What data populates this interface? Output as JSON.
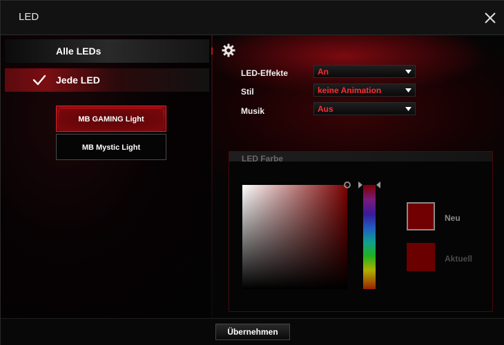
{
  "window": {
    "title": "LED"
  },
  "scope": {
    "all_label": "Alle LEDs",
    "each_label": "Jede LED"
  },
  "devices": [
    {
      "label": "MB GAMING Light",
      "selected": true
    },
    {
      "label": "MB Mystic Light",
      "selected": false
    }
  ],
  "settings": {
    "effects_label": "LED-Effekte",
    "effects_value": "An",
    "style_label": "Stil",
    "style_value": "keine Animation",
    "music_label": "Musik",
    "music_value": "Aus"
  },
  "color": {
    "group_title": "LED Farbe",
    "new_label": "Neu",
    "current_label": "Aktuell",
    "new_color": "#700002",
    "current_color": "#6a0000"
  },
  "footer": {
    "apply_label": "Übernehmen"
  },
  "theme": {
    "accent": "#c81218",
    "dropdown_text": "#ff2d34"
  }
}
